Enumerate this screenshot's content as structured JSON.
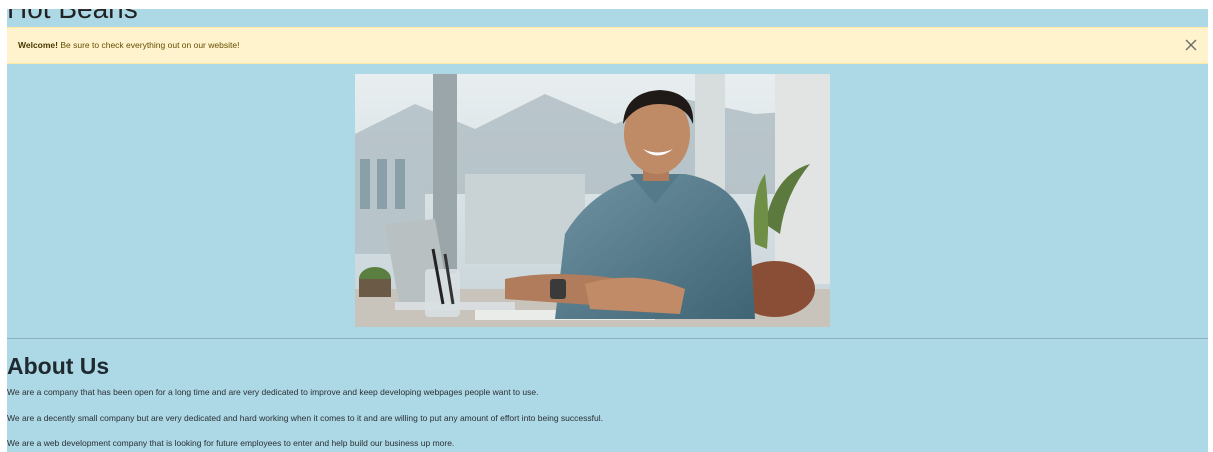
{
  "header": {
    "site_title": "Hot Beans"
  },
  "alert": {
    "strong": "Welcome!",
    "message": " Be sure to check everything out on our website!",
    "close_icon": "close-icon"
  },
  "hero": {
    "image": "smiling-man-at-desk-photo"
  },
  "about": {
    "heading": "About Us",
    "paragraphs": [
      "We are a company that has been open for a long time and are very dedicated to improve and keep developing webpages people want to use.",
      "We are a decently small company but are very dedicated and hard working when it comes to it and are willing to put any amount of effort into being successful.",
      "We are a web development company that is looking for future employees to enter and help build our business up more."
    ]
  },
  "colors": {
    "page_background": "#add8e6",
    "alert_background": "#fff3cd",
    "alert_text": "#664d03"
  }
}
